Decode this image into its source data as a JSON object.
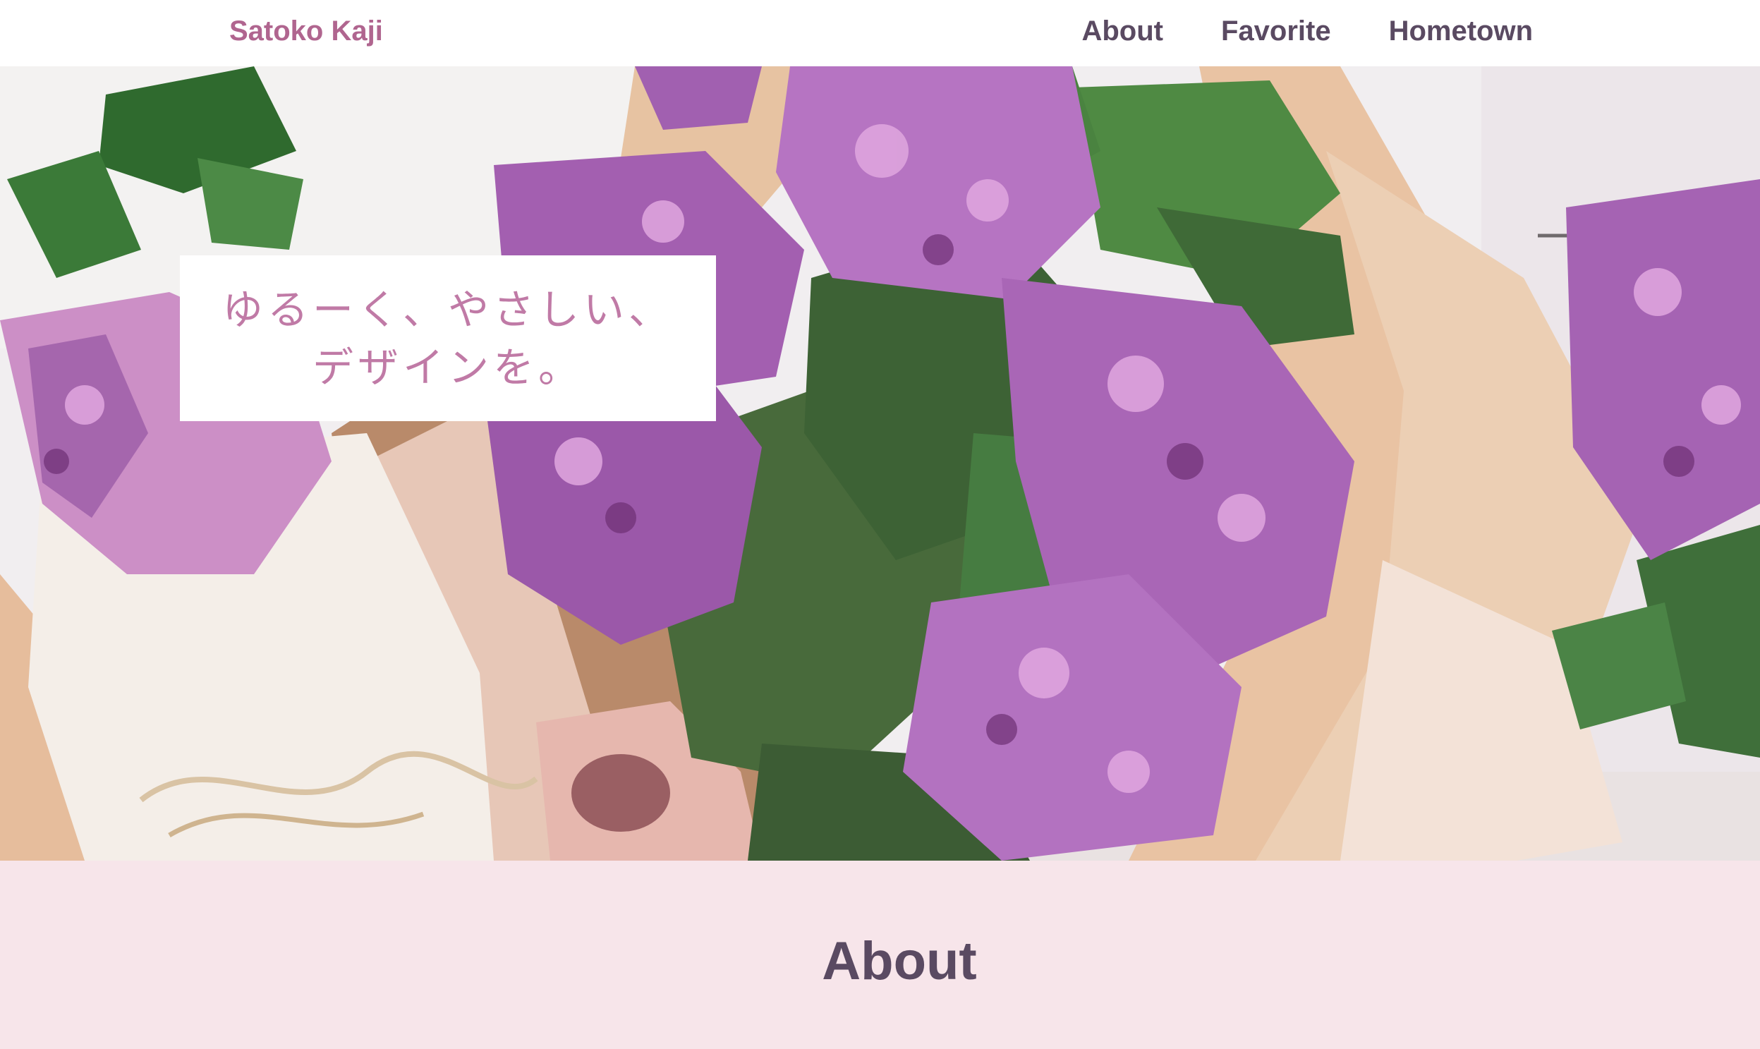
{
  "header": {
    "brand": "Satoko Kaji",
    "nav": [
      {
        "label": "About"
      },
      {
        "label": "Favorite"
      },
      {
        "label": "Hometown"
      }
    ]
  },
  "hero": {
    "tagline_line1": "ゆるーく、やさしい、",
    "tagline_line2": "デザインを。",
    "image": "lilac-bouquet-illustration"
  },
  "about": {
    "title": "About"
  },
  "colors": {
    "brand": "#b0658f",
    "nav_text": "#5a4a62",
    "tagline": "#c07aa6",
    "about_bg": "#f7e5ea"
  }
}
